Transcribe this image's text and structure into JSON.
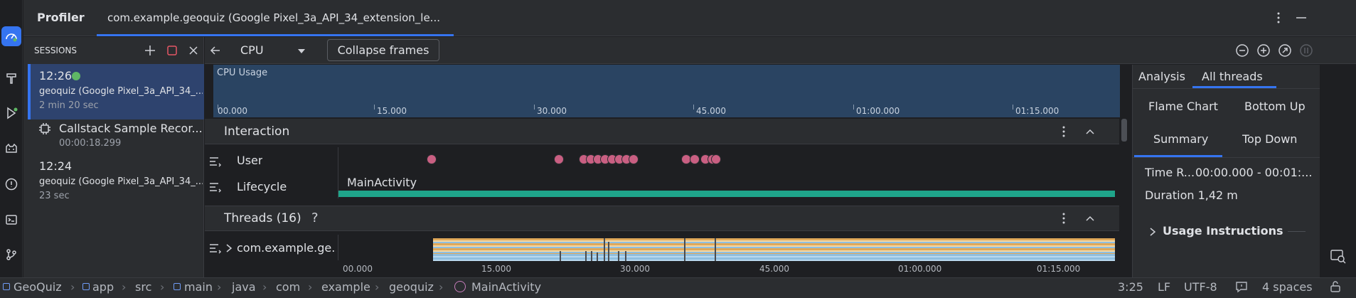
{
  "header": {
    "title": "Profiler",
    "device_tab": "com.example.geoquiz (Google Pixel_3a_API_34_extension_le..."
  },
  "sessions": {
    "title": "SESSIONS",
    "items": [
      {
        "time": "12:26",
        "device": "geoquiz (Google Pixel_3a_API_34_...",
        "duration": "2 min 20 sec",
        "live": true
      },
      {
        "time": "12:24",
        "device": "geoquiz (Google Pixel_3a_API_34_...",
        "duration": "23 sec",
        "live": false
      }
    ],
    "recording": {
      "name": "Callstack Sample Recor...",
      "duration": "00:00:18.299"
    }
  },
  "toolbar": {
    "cpu_select": "CPU",
    "collapse_frames": "Collapse frames"
  },
  "cpu_usage": {
    "label": "CPU Usage",
    "ticks": [
      "00.000",
      "15.000",
      "30.000",
      "45.000",
      "01:00.000",
      "01:15.000"
    ]
  },
  "interaction": {
    "title": "Interaction",
    "user_label": "User",
    "lifecycle_label": "Lifecycle",
    "activity": "MainActivity"
  },
  "threads": {
    "title": "Threads (16)",
    "help": "?",
    "row_label": "com.example.ge...",
    "ticks": [
      "00.000",
      "15.000",
      "30.000",
      "45.000",
      "01:00.000",
      "01:15.000"
    ]
  },
  "right_panel": {
    "tabs": [
      "Analysis",
      "All threads"
    ],
    "active_tab": "All threads",
    "view_tabs": [
      "Flame Chart",
      "Bottom Up",
      "Summary",
      "Top Down"
    ],
    "active_view": "Summary",
    "time_range_label": "Time R...",
    "time_range_value": "00:00.000 - 00:01:...",
    "duration": "Duration 1,42 m",
    "usage_instructions": "Usage Instructions"
  },
  "statusbar": {
    "crumbs": [
      "GeoQuiz",
      "app",
      "src",
      "main",
      "java",
      "com",
      "example",
      "geoquiz",
      "MainActivity"
    ],
    "position": "3:25",
    "line_sep": "LF",
    "encoding": "UTF-8",
    "indent": "4 spaces"
  },
  "colors": {
    "accent": "#3574f0",
    "live_dot": "#5fb865",
    "user_event": "#c95f82",
    "lifecycle": "#1fa58a",
    "cpu_bg": "#2a4462"
  }
}
